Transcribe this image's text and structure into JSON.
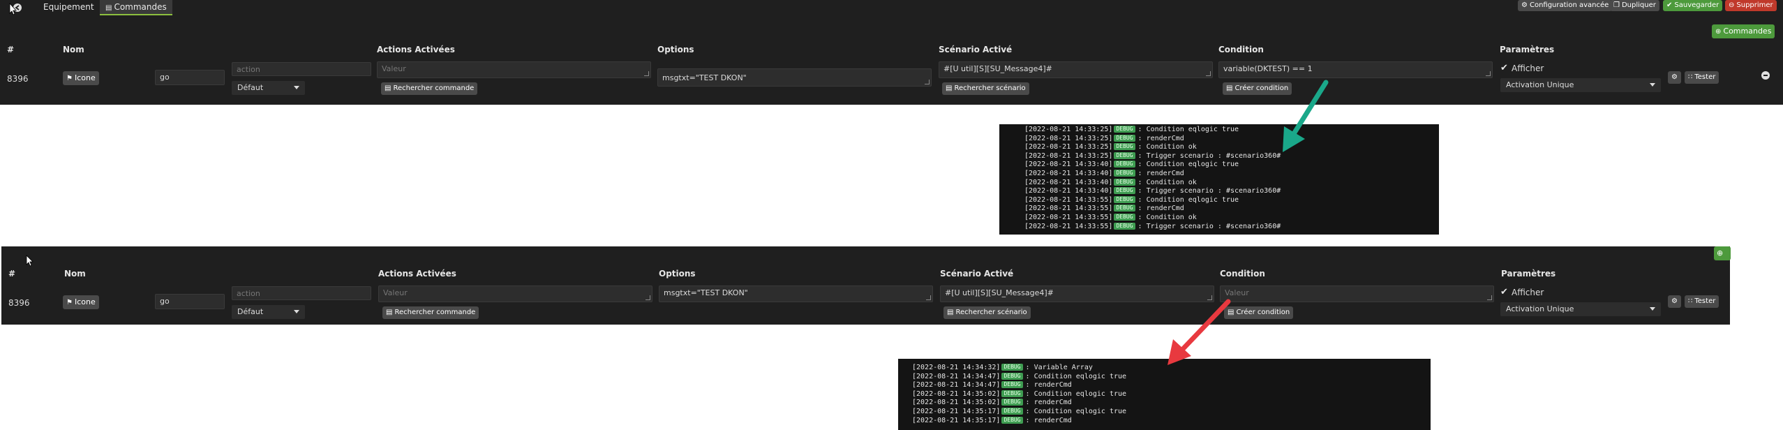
{
  "topbar": {
    "tabs": [
      "Equipement",
      "Commandes"
    ],
    "buttons": {
      "config": "Configuration avancée",
      "dup": "Dupliquer",
      "save": "Sauvegarder",
      "del": "Supprimer"
    },
    "commandes_add": "Commandes"
  },
  "headers": {
    "id": "#",
    "nom": "Nom",
    "actions": "Actions Activées",
    "options": "Options",
    "scenario": "Scénario Activé",
    "condition": "Condition",
    "params": "Paramètres"
  },
  "row1": {
    "id": "8396",
    "icone": "Icone",
    "nom": "go",
    "type_placeholder": "action",
    "subtype": "Défaut",
    "valeur_placeholder": "Valeur",
    "search_cmd": "Rechercher commande",
    "options": "msgtxt=\"TEST DKON\"",
    "scenario": "#[U util][S][SU_Message4]#",
    "search_scenario": "Rechercher scénario",
    "condition": "variable(DKTEST) == 1",
    "create_condition": "Créer condition",
    "afficher": "Afficher",
    "activation": "Activation Unique",
    "tester": "Tester"
  },
  "row2": {
    "id": "8396",
    "icone": "Icone",
    "nom": "go",
    "type_placeholder": "action",
    "subtype": "Défaut",
    "valeur_placeholder": "Valeur",
    "search_cmd": "Rechercher commande",
    "options": "msgtxt=\"TEST DKON\"",
    "scenario": "#[U util][S][SU_Message4]#",
    "search_scenario": "Rechercher scénario",
    "condition_placeholder": "Valeur",
    "create_condition": "Créer condition",
    "afficher": "Afficher",
    "activation": "Activation Unique",
    "tester": "Tester"
  },
  "badge": "DEBUG",
  "log1": [
    {
      "ts": "[2022-08-21 14:33:25]",
      "msg": ": Condition eqlogic true"
    },
    {
      "ts": "[2022-08-21 14:33:25]",
      "msg": ": renderCmd"
    },
    {
      "ts": "[2022-08-21 14:33:25]",
      "msg": ": Condition ok"
    },
    {
      "ts": "[2022-08-21 14:33:25]",
      "msg": ": Trigger scenario : #scenario360#"
    },
    {
      "ts": "[2022-08-21 14:33:40]",
      "msg": ": Condition eqlogic true"
    },
    {
      "ts": "[2022-08-21 14:33:40]",
      "msg": ": renderCmd"
    },
    {
      "ts": "[2022-08-21 14:33:40]",
      "msg": ": Condition ok"
    },
    {
      "ts": "[2022-08-21 14:33:40]",
      "msg": ": Trigger scenario : #scenario360#"
    },
    {
      "ts": "[2022-08-21 14:33:55]",
      "msg": ": Condition eqlogic true"
    },
    {
      "ts": "[2022-08-21 14:33:55]",
      "msg": ": renderCmd"
    },
    {
      "ts": "[2022-08-21 14:33:55]",
      "msg": ": Condition ok"
    },
    {
      "ts": "[2022-08-21 14:33:55]",
      "msg": ": Trigger scenario : #scenario360#"
    }
  ],
  "log2": [
    {
      "ts": "[2022-08-21 14:34:32]",
      "msg": ": Variable Array"
    },
    {
      "ts": "[2022-08-21 14:34:47]",
      "msg": ": Condition eqlogic true"
    },
    {
      "ts": "[2022-08-21 14:34:47]",
      "msg": ": renderCmd"
    },
    {
      "ts": "[2022-08-21 14:35:02]",
      "msg": ": Condition eqlogic true"
    },
    {
      "ts": "[2022-08-21 14:35:02]",
      "msg": ": renderCmd"
    },
    {
      "ts": "[2022-08-21 14:35:17]",
      "msg": ": Condition eqlogic true"
    },
    {
      "ts": "[2022-08-21 14:35:17]",
      "msg": ": renderCmd"
    }
  ],
  "colors": {
    "arrow1": "#1aa88a",
    "arrow2": "#e8393f",
    "accent": "#8cbf3f"
  }
}
